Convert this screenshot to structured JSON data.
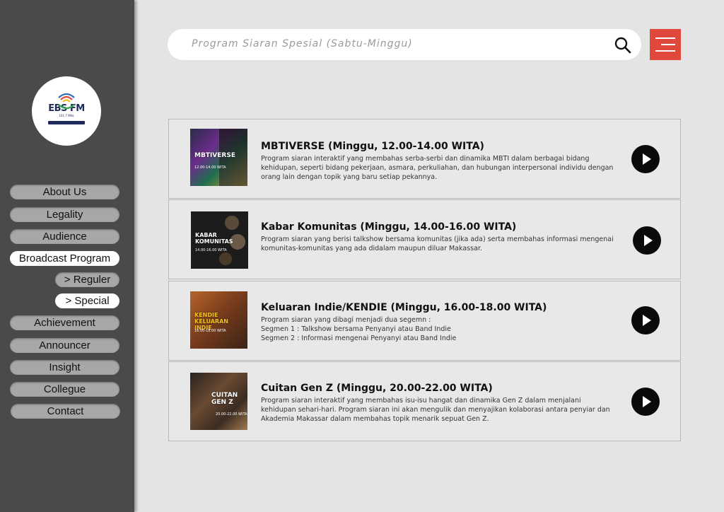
{
  "brand": {
    "logo_text": "EBS FM",
    "logo_freq": "101.7 MHz",
    "colors": {
      "sidebar": "#4a4a4c",
      "accent": "#e0483c",
      "nav_idle": "#a7a7a9",
      "nav_active": "#ffffff"
    }
  },
  "sidebar": {
    "items": [
      {
        "label": "About Us",
        "active": false
      },
      {
        "label": "Legality",
        "active": false
      },
      {
        "label": "Audience",
        "active": false
      },
      {
        "label": "Broadcast Program",
        "active": true
      },
      {
        "label": "> Reguler",
        "active": false,
        "sub": true
      },
      {
        "label": "> Special",
        "active": true,
        "sub": true
      },
      {
        "label": "Achievement",
        "active": false
      },
      {
        "label": "Announcer",
        "active": false
      },
      {
        "label": "Insight",
        "active": false
      },
      {
        "label": "Collegue",
        "active": false
      },
      {
        "label": "Contact",
        "active": false
      }
    ]
  },
  "search": {
    "placeholder": "Program Siaran Spesial (Sabtu-Minggu)",
    "icon": "search-icon"
  },
  "menu": {
    "icon": "hamburger-icon"
  },
  "programs": [
    {
      "title": "MBTIVERSE (Minggu, 12.00-14.00 WITA)",
      "desc": "Program siaran interaktif yang membahas serba-serbi dan dinamika MBTI dalam berbagai bidang kehidupan, seperti bidang pekerjaan, asmara, perkuliahan, dan hubungan interpersonal individu dengan orang lain dengan topik yang baru setiap pekannya.",
      "thumb_label": "MBTIVERSE",
      "thumb_sub": "12.00-14.00 WITA"
    },
    {
      "title": "Kabar Komunitas (Minggu, 14.00-16.00 WITA)",
      "desc": "Program siaran yang berisi talkshow bersama komunitas (jika ada) serta membahas informasi mengenai komunitas-komunitas yang ada didalam maupun diluar Makassar.",
      "thumb_label": "KABAR KOMUNITAS",
      "thumb_sub": "14.00-16.00 WITA"
    },
    {
      "title": "Keluaran Indie/KENDIE (Minggu, 16.00-18.00 WITA)",
      "desc_lines": [
        "Program siaran yang dibagi menjadi dua segemn :",
        "Segmen 1 : Talkshow bersama Penyanyi atau Band Indie",
        "Segmen 2 : Informasi mengenai Penyanyi atau Band Indie"
      ],
      "thumb_label": "KENDIE KELUARAN INDIE",
      "thumb_sub": "16.00-18.00 WITA"
    },
    {
      "title": "Cuitan Gen Z (Minggu, 20.00-22.00 WITA)",
      "desc": "Program siaran interaktif yang membahas isu-isu hangat dan dinamika Gen Z dalam menjalani kehidupan sehari-hari. Program siaran ini akan mengulik dan menyajikan kolaborasi antara penyiar dan Akademia Makassar dalam membahas topik menarik sepuat Gen Z.",
      "thumb_label": "CUITAN GEN Z",
      "thumb_sub": "20.00-22.00 WITA"
    }
  ]
}
